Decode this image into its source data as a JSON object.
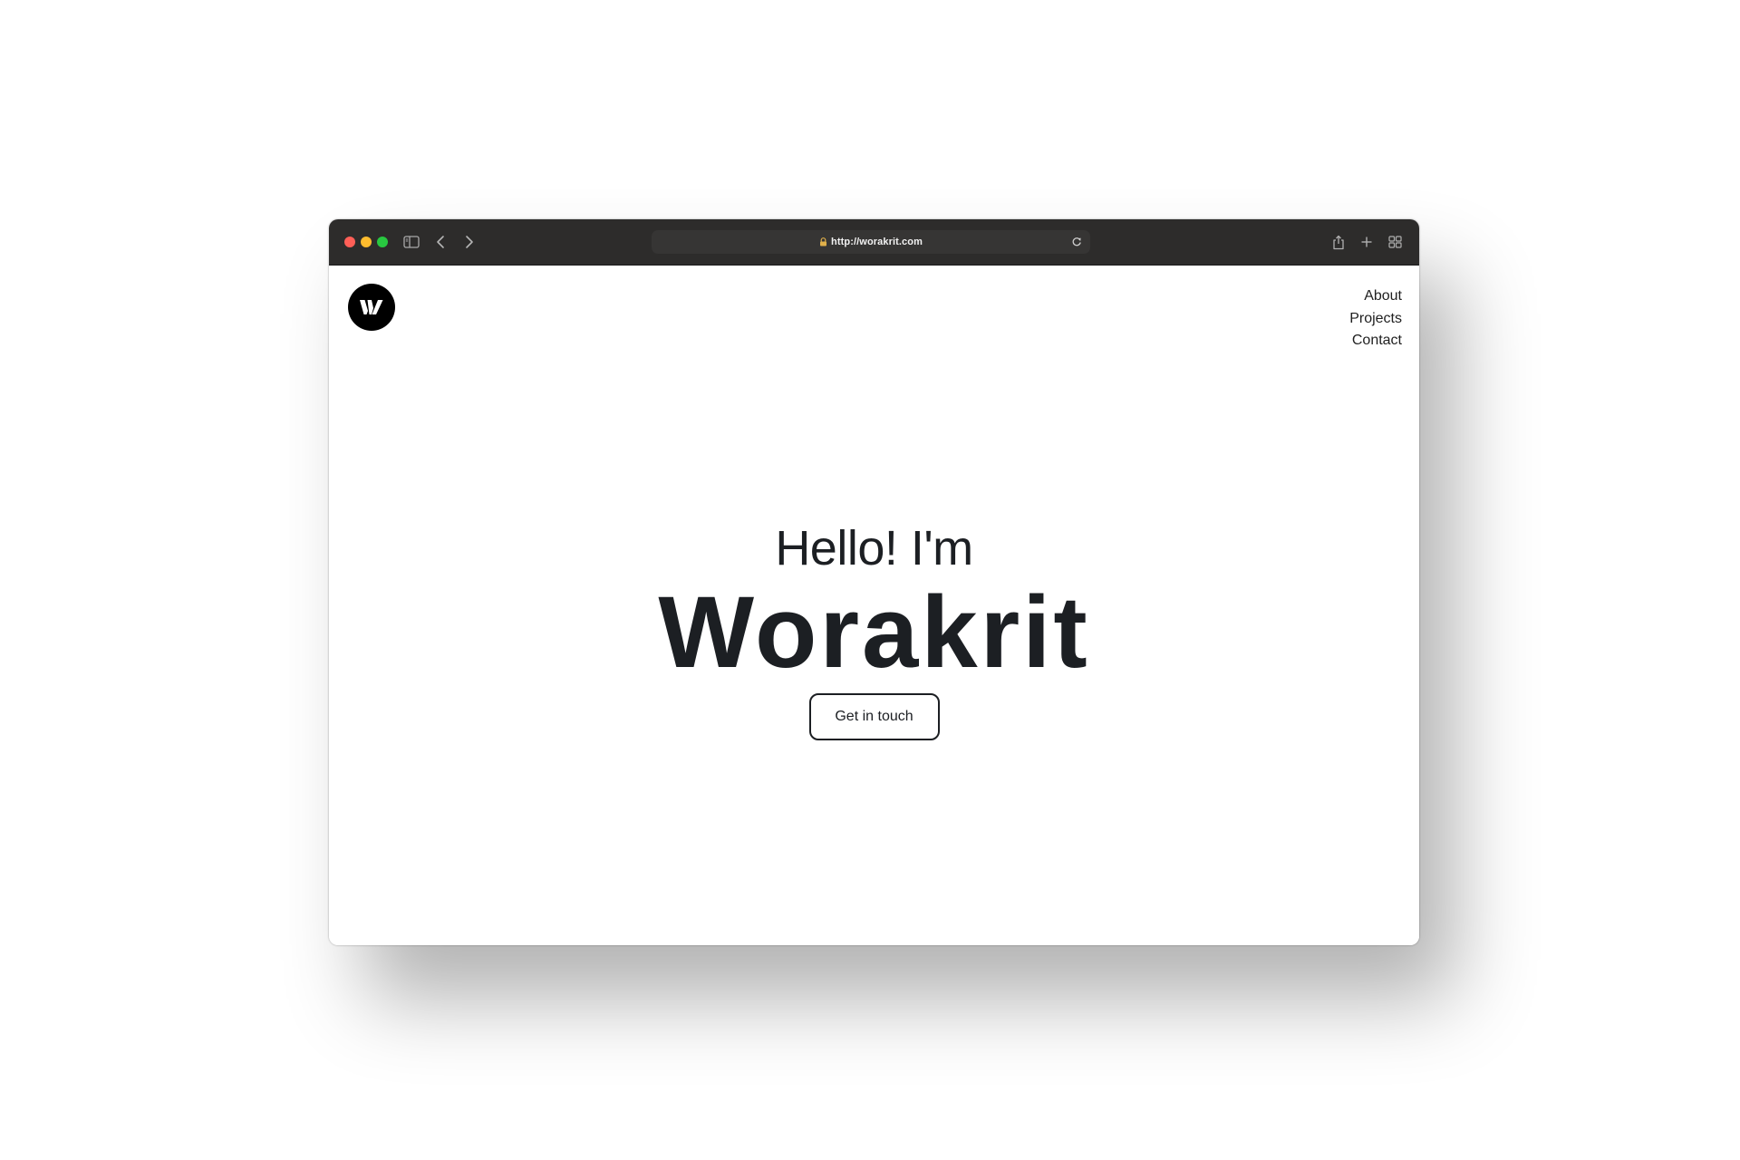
{
  "browser": {
    "url": "http://worakrit.com",
    "icons": [
      "sidebar-icon",
      "back-icon",
      "forward-icon",
      "lock-icon",
      "reload-icon",
      "share-icon",
      "new-tab-icon",
      "tab-overview-icon"
    ]
  },
  "site": {
    "logo_icon": "worakrit-logo-icon",
    "nav": {
      "about": "About",
      "projects": "Projects",
      "contact": "Contact"
    },
    "hero": {
      "greeting": "Hello! I'm",
      "name": "Worakrit",
      "cta": "Get in touch"
    }
  },
  "colors": {
    "toolbar": "#2d2c2b",
    "text": "#1c1f23",
    "logo_bg": "#000000"
  }
}
